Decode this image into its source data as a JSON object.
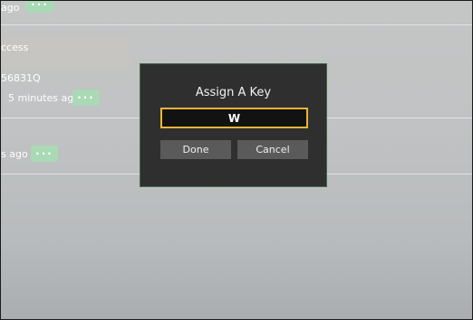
{
  "list": {
    "row1": {
      "time": "ago",
      "menu_label": "···"
    },
    "row2": {
      "title": "ccess",
      "code": "56831Q",
      "time": "5 minutes ago",
      "menu_label": "···"
    },
    "row3": {
      "time": "s ago",
      "menu_label": "···"
    }
  },
  "dialog": {
    "title": "Assign A Key",
    "key_value": "W",
    "done_label": "Done",
    "cancel_label": "Cancel"
  },
  "colors": {
    "accent_green": "#a9d9b4",
    "input_border": "#e8b636",
    "dialog_bg": "#2f2f2f",
    "button_bg": "#5a5a5a"
  }
}
